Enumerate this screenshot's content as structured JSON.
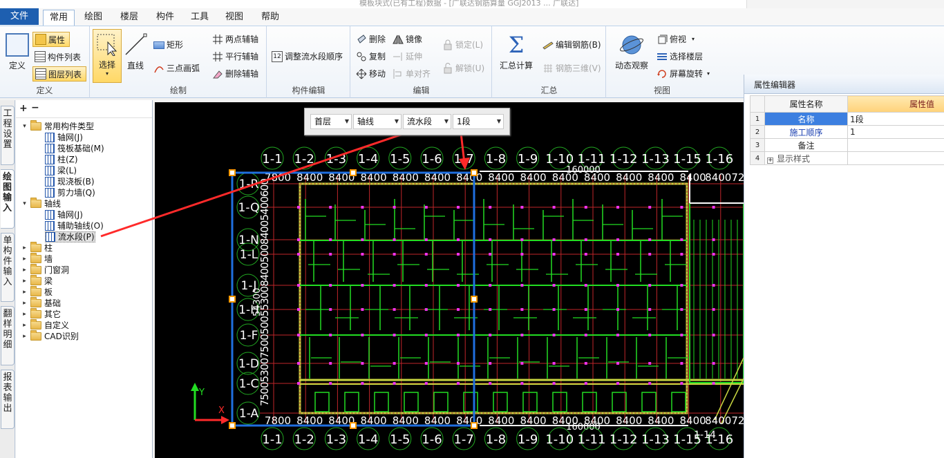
{
  "titlebar": {
    "faded_text": "模板块式(已有工程)数据 - [广联达钢筋算量 GGJ2013 ... 广联达]"
  },
  "menu": {
    "file": "文件",
    "tabs": [
      {
        "label": "常用",
        "active": true
      },
      {
        "label": "绘图"
      },
      {
        "label": "楼层"
      },
      {
        "label": "构件"
      },
      {
        "label": "工具"
      },
      {
        "label": "视图"
      },
      {
        "label": "帮助"
      }
    ]
  },
  "ribbon": {
    "define": {
      "label": "定义",
      "btn": "定义",
      "attr": "属性",
      "comp_list": "构件列表",
      "layer_list": "图层列表"
    },
    "draw": {
      "label": "绘制",
      "select": "选择",
      "line": "直线",
      "rect": "矩形",
      "arc": "三点画弧",
      "two_pt_axis": "两点辅轴",
      "parallel_axis": "平行辅轴",
      "del_axis": "删除辅轴"
    },
    "comp_edit": {
      "label": "构件编辑",
      "adjust_order": "调整流水段顺序"
    },
    "edit": {
      "label": "编辑",
      "delete": "删除",
      "mirror": "镜像",
      "copy": "复制",
      "extend": "延伸",
      "move": "移动",
      "align": "单对齐",
      "lock": "锁定(L)",
      "unlock": "解锁(U)"
    },
    "summary": {
      "label": "汇总",
      "calc": "汇总计算",
      "edit_rebar": "编辑钢筋(B)",
      "rebar3d": "钢筋三维(V)"
    },
    "view": {
      "label": "视图",
      "dynamic": "动态观察",
      "top_view": "俯视",
      "select_floor": "选择楼层",
      "rotate": "屏幕旋转"
    }
  },
  "vtabs": [
    "工程设置",
    "绘图输入",
    "单构件输入",
    "翻样明细",
    "报表输出"
  ],
  "tree": {
    "groups": [
      {
        "label": "常用构件类型",
        "expanded": true,
        "children": [
          "轴网(J)",
          "筏板基础(M)",
          "柱(Z)",
          "梁(L)",
          "现浇板(B)",
          "剪力墙(Q)"
        ]
      },
      {
        "label": "轴线",
        "expanded": true,
        "children": [
          "轴网(J)",
          "辅助轴线(O)",
          "流水段(P)"
        ]
      },
      {
        "label": "柱"
      },
      {
        "label": "墙"
      },
      {
        "label": "门窗洞"
      },
      {
        "label": "梁"
      },
      {
        "label": "板"
      },
      {
        "label": "基础"
      },
      {
        "label": "其它"
      },
      {
        "label": "自定义"
      },
      {
        "label": "CAD识别"
      }
    ]
  },
  "floatbar": {
    "floor": "首层",
    "category": "轴线",
    "type": "流水段",
    "segment": "1段"
  },
  "drawing": {
    "axis_top": [
      "1-1",
      "1-2",
      "1-3",
      "1-4",
      "1-5",
      "1-6",
      "1-7",
      "1-8",
      "1-9",
      "1-10",
      "1-11",
      "1-12",
      "1-13",
      "1-15",
      "1-16"
    ],
    "axis_bottom": [
      "1-1",
      "1-2",
      "1-3",
      "1-4",
      "1-5",
      "1-6",
      "1-7",
      "1-8",
      "1-9",
      "1-10",
      "1-11",
      "1-12",
      "1-13",
      "1-15",
      "1-16"
    ],
    "axis_left": [
      "1-R",
      "1-Q",
      "1-N",
      "1-L",
      "1-J",
      "1-H",
      "1-F",
      "1-D",
      "1-C",
      "1-A"
    ],
    "dims_top": [
      "7800",
      "8400",
      "8400",
      "8400",
      "8400",
      "8400",
      "8400",
      "8400",
      "8400",
      "8400",
      "8400",
      "8400",
      "8400",
      "8400",
      "840072"
    ],
    "total_top": "160000",
    "total_bottom": "160000",
    "left_dims": "75005300750050055300840050084005400600",
    "left_total": "54300",
    "axis_x_label": "X",
    "axis_y_label": "Y",
    "axis_extra": "1-14"
  },
  "props": {
    "title": "属性编辑器",
    "col_name": "属性名称",
    "col_value": "属性值",
    "rows": [
      {
        "idx": "1",
        "name": "名称",
        "value": "1段"
      },
      {
        "idx": "2",
        "name": "施工顺序",
        "value": "1"
      },
      {
        "idx": "3",
        "name": "备注",
        "value": ""
      },
      {
        "idx": "4",
        "name": "显示样式",
        "value": ""
      }
    ]
  },
  "colors": {
    "accent": "#1e5fb0",
    "highlight": "#ffd866",
    "segment_blue": "#1f6fe0",
    "arrow_red": "#ff2a2a",
    "green": "#22dd22"
  }
}
